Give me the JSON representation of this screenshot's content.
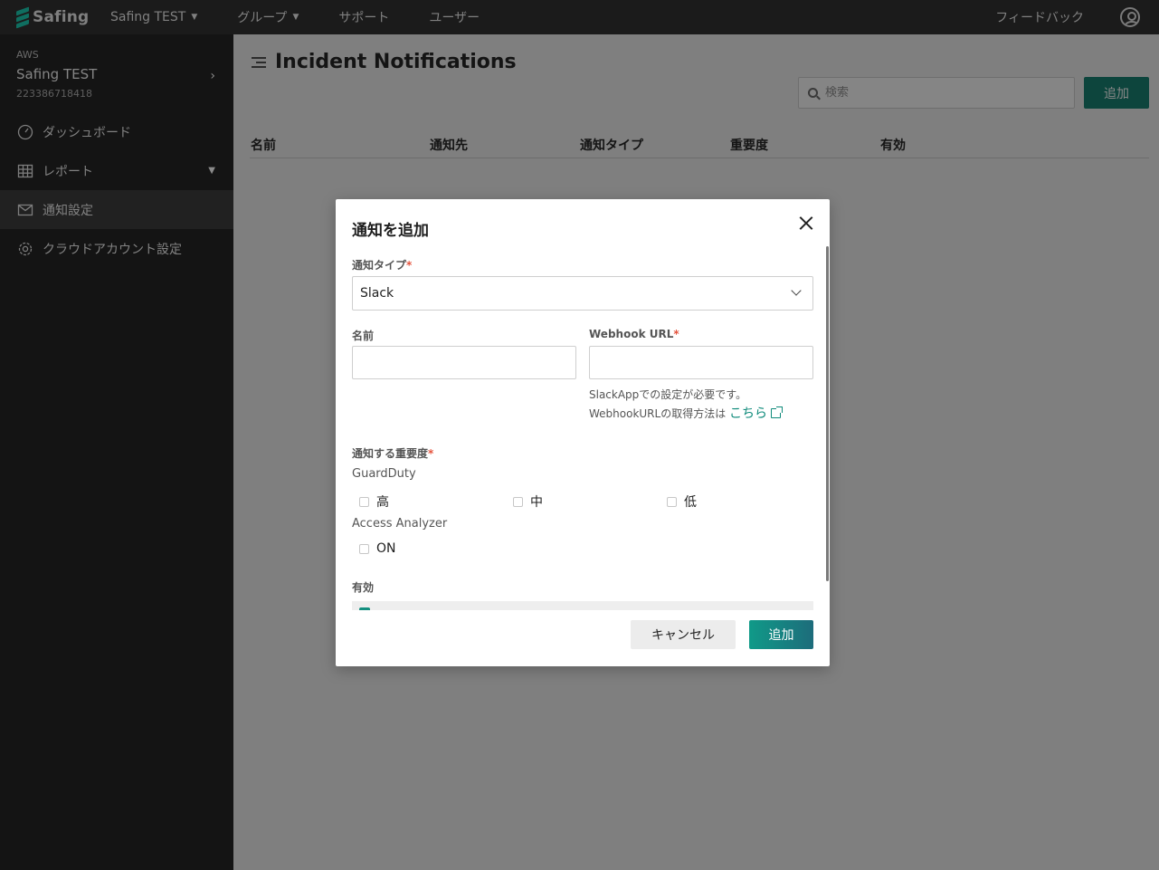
{
  "topbar": {
    "logo_text": "Safing",
    "nav": [
      {
        "label": "Safing TEST",
        "dropdown": true
      },
      {
        "label": "グループ",
        "dropdown": true
      },
      {
        "label": "サポート",
        "dropdown": false
      },
      {
        "label": "ユーザー",
        "dropdown": false
      }
    ],
    "feedback": "フィードバック"
  },
  "sidebar": {
    "account": {
      "provider": "AWS",
      "name": "Safing TEST",
      "id": "223386718418"
    },
    "items": [
      {
        "label": "ダッシュボード",
        "icon": "gauge-icon"
      },
      {
        "label": "レポート",
        "icon": "grid-icon",
        "expandable": true
      },
      {
        "label": "通知設定",
        "icon": "mail-icon",
        "active": true
      },
      {
        "label": "クラウドアカウント設定",
        "icon": "gear-icon"
      }
    ]
  },
  "main": {
    "title": "Incident Notifications",
    "search_placeholder": "検索",
    "add_label": "追加",
    "columns": [
      "名前",
      "通知先",
      "通知タイプ",
      "重要度",
      "有効"
    ]
  },
  "modal": {
    "title": "通知を追加",
    "type_label": "通知タイプ",
    "type_value": "Slack",
    "name_label": "名前",
    "name_value": "",
    "webhook_label": "Webhook URL",
    "webhook_value": "",
    "help_line1": "SlackAppでの設定が必要です。",
    "help_line2": "WebhookURLの取得方法は",
    "help_link": "こちら",
    "severity_label": "通知する重要度",
    "guardduty_label": "GuardDuty",
    "guardduty_options": [
      "高",
      "中",
      "低"
    ],
    "access_analyzer_label": "Access Analyzer",
    "access_analyzer_option": "ON",
    "enabled_label": "有効",
    "cancel_label": "キャンセル",
    "submit_label": "追加"
  },
  "colors": {
    "accent": "#109a88",
    "required": "#e5533d",
    "link": "#0e8a7a"
  }
}
